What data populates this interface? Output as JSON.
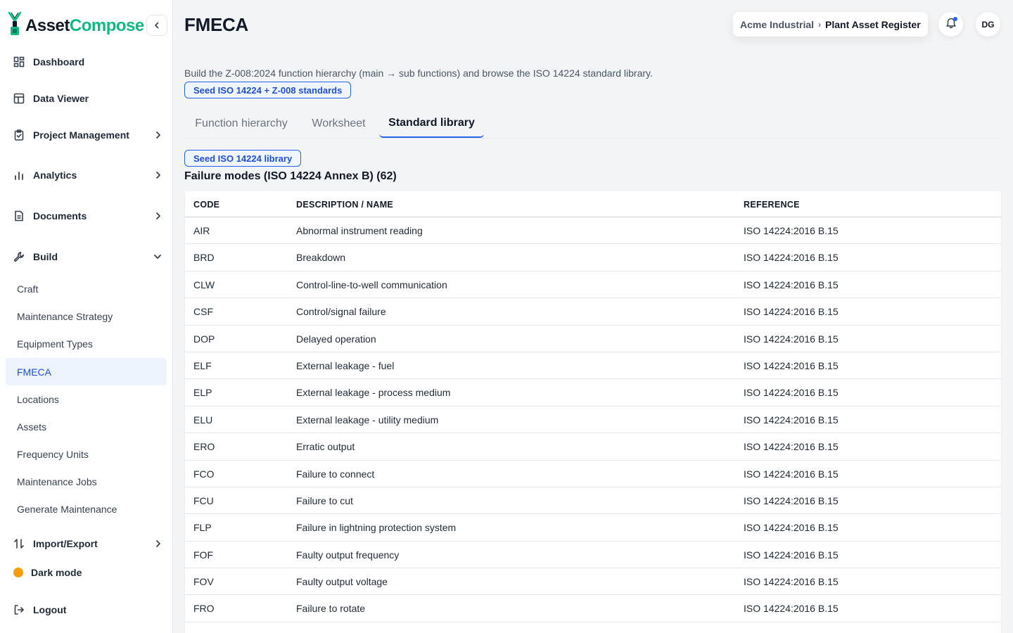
{
  "brand": {
    "part1": "Asset",
    "part2": "Compose"
  },
  "sidebar": {
    "collapse_icon": "chevron-left-icon",
    "items": [
      {
        "label": "Dashboard",
        "icon": "dashboard-icon"
      },
      {
        "label": "Data Viewer",
        "icon": "table-icon"
      },
      {
        "label": "Project Management",
        "icon": "clipboard-icon"
      },
      {
        "label": "Analytics",
        "icon": "bar-chart-icon"
      },
      {
        "label": "Documents",
        "icon": "document-icon"
      },
      {
        "label": "Build",
        "icon": "wrench-icon"
      },
      {
        "label": "Import/Export",
        "icon": "swap-icon"
      },
      {
        "label": "Dark mode",
        "icon": "theme-dot-icon"
      },
      {
        "label": "Logout",
        "icon": "logout-icon"
      }
    ],
    "build_children": [
      "Craft",
      "Maintenance Strategy",
      "Equipment Types",
      "FMECA",
      "Locations",
      "Assets",
      "Frequency Units",
      "Maintenance Jobs",
      "Generate Maintenance"
    ],
    "active_child": "FMECA"
  },
  "header": {
    "title": "FMECA",
    "breadcrumb": {
      "org": "Acme Industrial",
      "separator": "›",
      "register": "Plant Asset Register"
    },
    "avatar_initials": "DG",
    "accent_color": "#2563eb",
    "brand_green": "#10b981"
  },
  "main": {
    "description": "Build the Z-008:2024 function hierarchy (main → sub functions) and browse the ISO 14224 standard library.",
    "seed_standards_label": "Seed ISO 14224 + Z-008 standards",
    "tabs": [
      "Function hierarchy",
      "Worksheet",
      "Standard library"
    ],
    "active_tab": "Standard library",
    "seed_library_label": "Seed ISO 14224 library",
    "section_title": "Failure modes (ISO 14224 Annex B) (62)",
    "table": {
      "headers": [
        "CODE",
        "DESCRIPTION / NAME",
        "REFERENCE"
      ],
      "rows": [
        [
          "AIR",
          "Abnormal instrument reading",
          "ISO 14224:2016 B.15"
        ],
        [
          "BRD",
          "Breakdown",
          "ISO 14224:2016 B.15"
        ],
        [
          "CLW",
          "Control-line-to-well communication",
          "ISO 14224:2016 B.15"
        ],
        [
          "CSF",
          "Control/signal failure",
          "ISO 14224:2016 B.15"
        ],
        [
          "DOP",
          "Delayed operation",
          "ISO 14224:2016 B.15"
        ],
        [
          "ELF",
          "External leakage - fuel",
          "ISO 14224:2016 B.15"
        ],
        [
          "ELP",
          "External leakage - process medium",
          "ISO 14224:2016 B.15"
        ],
        [
          "ELU",
          "External leakage - utility medium",
          "ISO 14224:2016 B.15"
        ],
        [
          "ERO",
          "Erratic output",
          "ISO 14224:2016 B.15"
        ],
        [
          "FCO",
          "Failure to connect",
          "ISO 14224:2016 B.15"
        ],
        [
          "FCU",
          "Failure to cut",
          "ISO 14224:2016 B.15"
        ],
        [
          "FLP",
          "Failure in lightning protection system",
          "ISO 14224:2016 B.15"
        ],
        [
          "FOF",
          "Faulty output frequency",
          "ISO 14224:2016 B.15"
        ],
        [
          "FOV",
          "Faulty output voltage",
          "ISO 14224:2016 B.15"
        ],
        [
          "FRO",
          "Failure to rotate",
          "ISO 14224:2016 B.15"
        ]
      ]
    }
  }
}
